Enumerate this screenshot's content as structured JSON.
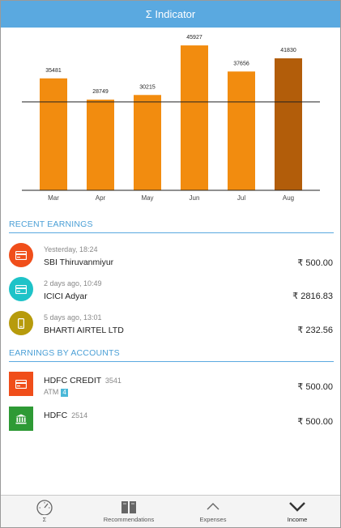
{
  "header": {
    "title": "Σ Indicator"
  },
  "chart_data": {
    "type": "bar",
    "categories": [
      "Mar",
      "Apr",
      "May",
      "Jun",
      "Jul",
      "Aug"
    ],
    "values": [
      35481,
      28749,
      30215,
      45927,
      37656,
      41830
    ],
    "value_labels": [
      "35481",
      "28749",
      "30215",
      "45927",
      "37656",
      "41830"
    ],
    "highlighted_index": 5,
    "bar_color": "#f28c0f",
    "highlight_color": "#b25d0a",
    "ylim": [
      0,
      48000
    ],
    "reference_line": 28000
  },
  "recent_earnings": {
    "title": "RECENT EARNINGS",
    "items": [
      {
        "time": "Yesterday, 18:24",
        "name": "SBI Thiruvanmiyur",
        "amount": "₹ 500.00",
        "icon": "card-icon",
        "color": "#f04e1a"
      },
      {
        "time": "2 days ago, 10:49",
        "name": "ICICI Adyar",
        "amount": "₹ 2816.83",
        "icon": "card-icon",
        "color": "#1ec3c8"
      },
      {
        "time": "5 days ago, 13:01",
        "name": "BHARTI AIRTEL LTD",
        "amount": "₹ 232.56",
        "icon": "phone-icon",
        "color": "#b79b0c"
      }
    ]
  },
  "earnings_by_accounts": {
    "title": "EARNINGS BY ACCOUNTS",
    "items": [
      {
        "name": "HDFC CREDIT",
        "account": "3541",
        "sub": "ATM",
        "badge": "4",
        "amount": "₹ 500.00",
        "icon": "card-icon",
        "color": "#f04e1a"
      },
      {
        "name": "HDFC",
        "account": "2514",
        "amount": "₹ 500.00",
        "icon": "bank-icon",
        "color": "#2e9a35"
      }
    ]
  },
  "bottom_nav": {
    "items": [
      {
        "label": "Σ",
        "icon": "gauge-icon"
      },
      {
        "label": "Recommendations",
        "icon": "book-icon"
      },
      {
        "label": "Expenses",
        "icon": "chevron-up-icon"
      },
      {
        "label": "Income",
        "icon": "chevron-down-icon",
        "active": true
      }
    ]
  }
}
